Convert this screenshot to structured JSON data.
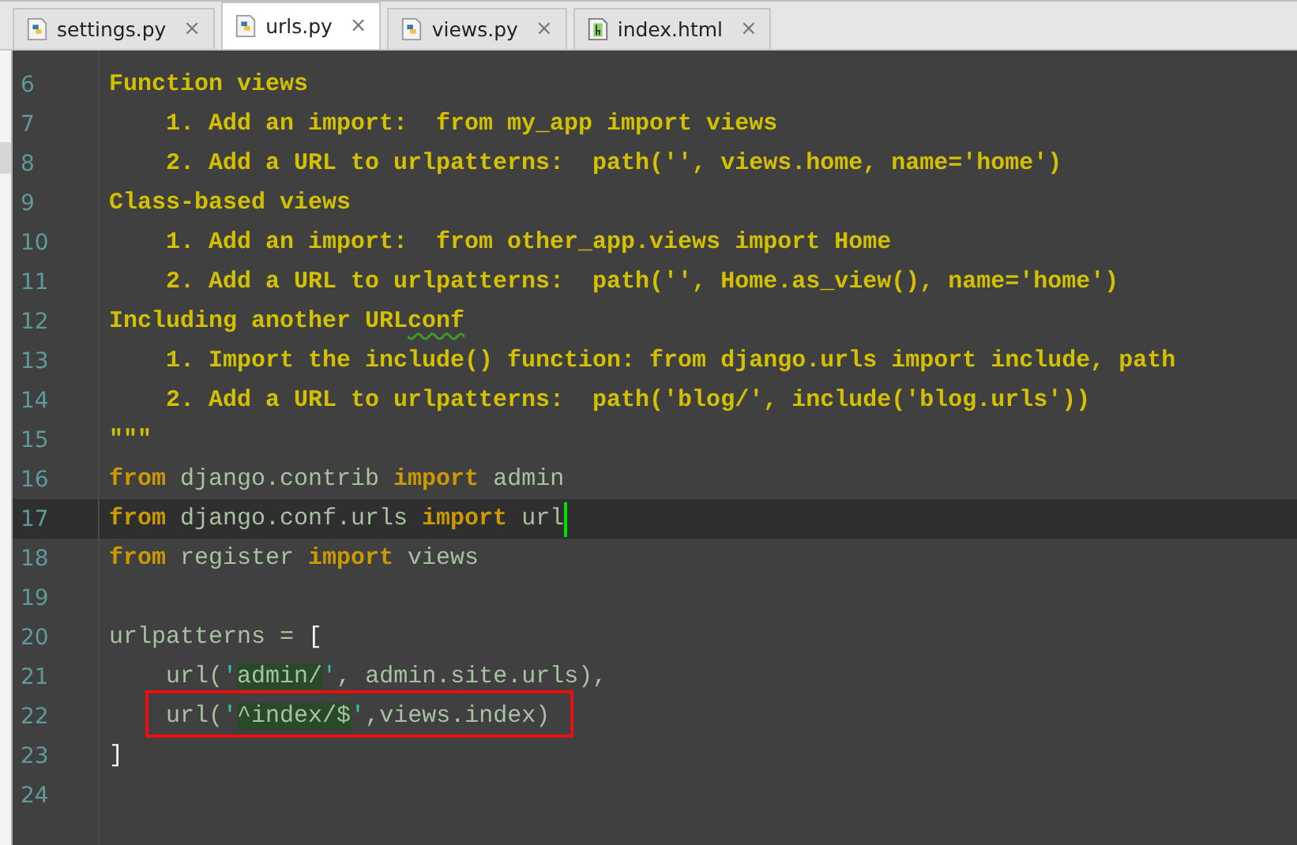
{
  "tabs": [
    {
      "label": "settings.py",
      "kind": "python",
      "selected": false,
      "close": "×"
    },
    {
      "label": "urls.py",
      "kind": "python",
      "selected": true,
      "close": "×"
    },
    {
      "label": "views.py",
      "kind": "python",
      "selected": false,
      "close": "×"
    },
    {
      "label": "index.html",
      "kind": "html",
      "selected": false,
      "close": "×"
    }
  ],
  "lines": [
    {
      "number": "6",
      "tokens": [
        {
          "kind": "doc",
          "text": "Function views"
        }
      ]
    },
    {
      "number": "7",
      "tokens": [
        {
          "kind": "doc",
          "text": "    1. Add an import:  from my_app import views"
        }
      ]
    },
    {
      "number": "8",
      "tokens": [
        {
          "kind": "doc",
          "text": "    2. Add a URL to urlpatterns:  path('', views.home, name='home')"
        }
      ]
    },
    {
      "number": "9",
      "tokens": [
        {
          "kind": "doc",
          "text": "Class-based views"
        }
      ]
    },
    {
      "number": "10",
      "tokens": [
        {
          "kind": "doc",
          "text": "    1. Add an import:  from other_app.views import Home"
        }
      ]
    },
    {
      "number": "11",
      "tokens": [
        {
          "kind": "doc",
          "text": "    2. Add a URL to urlpatterns:  path('', Home.as_view(), name='home')"
        }
      ]
    },
    {
      "number": "12",
      "tokens": [
        {
          "kind": "doc",
          "text": "Including another URL"
        },
        {
          "kind": "doc_typo",
          "text": "conf"
        }
      ]
    },
    {
      "number": "13",
      "tokens": [
        {
          "kind": "doc",
          "text": "    1. Import the include() function: from django.urls import include, path"
        }
      ]
    },
    {
      "number": "14",
      "tokens": [
        {
          "kind": "doc",
          "text": "    2. Add a URL to urlpatterns:  path('blog/', include('blog.urls'))"
        }
      ]
    },
    {
      "number": "15",
      "tokens": [
        {
          "kind": "doc",
          "text": "\"\"\""
        }
      ]
    },
    {
      "number": "16",
      "tokens": [
        {
          "kind": "kw",
          "text": "from"
        },
        {
          "kind": "plain",
          "text": " django.contrib "
        },
        {
          "kind": "kw",
          "text": "import"
        },
        {
          "kind": "plain",
          "text": " admin"
        }
      ]
    },
    {
      "number": "17",
      "current": true,
      "caret": true,
      "tokens": [
        {
          "kind": "kw",
          "text": "from"
        },
        {
          "kind": "plain",
          "text": " django.conf.urls "
        },
        {
          "kind": "kw",
          "text": "import"
        },
        {
          "kind": "plain",
          "text": " url"
        }
      ]
    },
    {
      "number": "18",
      "tokens": [
        {
          "kind": "kw",
          "text": "from"
        },
        {
          "kind": "plain",
          "text": " register "
        },
        {
          "kind": "kw",
          "text": "import"
        },
        {
          "kind": "plain",
          "text": " views"
        }
      ]
    },
    {
      "number": "19"
    },
    {
      "number": "20",
      "tokens": [
        {
          "kind": "plain",
          "text": "urlpatterns = "
        },
        {
          "kind": "bracket",
          "text": "["
        }
      ]
    },
    {
      "number": "21",
      "tokens": [
        {
          "kind": "plain",
          "text": "    url("
        },
        {
          "kind": "quote",
          "text": "'"
        },
        {
          "kind": "str",
          "text": "admin/"
        },
        {
          "kind": "quote",
          "text": "'"
        },
        {
          "kind": "plain",
          "text": ", admin.site.urls),"
        }
      ]
    },
    {
      "number": "22",
      "annotated": true,
      "tokens": [
        {
          "kind": "plain",
          "text": "    url("
        },
        {
          "kind": "quote",
          "text": "'"
        },
        {
          "kind": "str",
          "text": "^index/$"
        },
        {
          "kind": "quote",
          "text": "'"
        },
        {
          "kind": "plain",
          "text": ",views.index)"
        }
      ]
    },
    {
      "number": "23",
      "tokens": [
        {
          "kind": "bracket",
          "text": "]"
        }
      ]
    },
    {
      "number": "24"
    }
  ]
}
